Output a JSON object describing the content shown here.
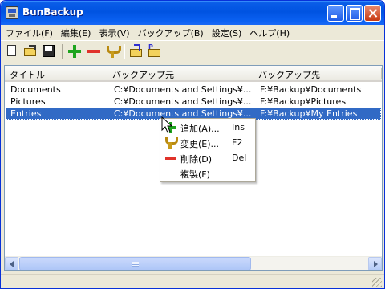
{
  "window": {
    "title": "BunBackup"
  },
  "menu": [
    {
      "label": "ファイル(F)"
    },
    {
      "label": "編集(E)"
    },
    {
      "label": "表示(V)"
    },
    {
      "label": "バックアップ(B)"
    },
    {
      "label": "設定(S)"
    },
    {
      "label": "ヘルプ(H)"
    }
  ],
  "toolbar": {
    "icons": [
      "new-file-icon",
      "open-folder-icon",
      "save-icon",
      "add-icon",
      "remove-icon",
      "edit-icon",
      "project-open-icon",
      "project-recent-icon"
    ]
  },
  "list": {
    "columns": [
      "タイトル",
      "バックアップ元",
      "バックアップ先"
    ],
    "rows": [
      {
        "title": "Documents",
        "source": "C:¥Documents and Settings¥...",
        "dest": "F:¥Backup¥Documents",
        "selected": false
      },
      {
        "title": "Pictures",
        "source": "C:¥Documents and Settings¥...",
        "dest": "F:¥Backup¥Pictures",
        "selected": false
      },
      {
        "title": "Entries",
        "source": "C:¥Documents and Settings¥...",
        "dest": "F:¥Backup¥My Entries",
        "selected": true
      }
    ]
  },
  "context_menu": [
    {
      "label": "追加(A)...",
      "shortcut": "Ins",
      "icon": "add-icon"
    },
    {
      "label": "変更(E)...",
      "shortcut": "F2",
      "icon": "edit-icon"
    },
    {
      "label": "削除(D)",
      "shortcut": "Del",
      "icon": "remove-icon"
    },
    {
      "label": "複製(F)",
      "shortcut": "",
      "icon": ""
    }
  ],
  "colors": {
    "titlebar": "#0053e1",
    "selection": "#316ac5",
    "face": "#ece9d8"
  }
}
